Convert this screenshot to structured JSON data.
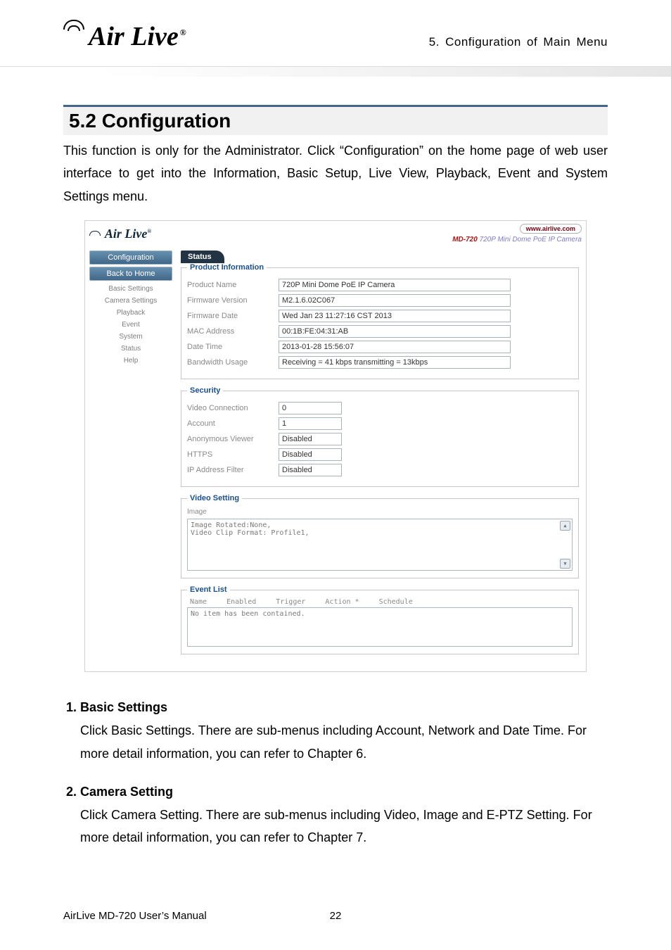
{
  "header": {
    "brand": "Air Live",
    "section_label": "5.  Configuration  of  Main  Menu"
  },
  "section_title": "5.2 Configuration",
  "section_paragraph": "This function is only for the Administrator. Click “Configuration” on the home page of web user interface to get into the Information, Basic Setup, Live View, Playback, Event and System Settings menu.",
  "ui": {
    "top": {
      "brand": "Air Live",
      "url": "www.airlive.com",
      "product_code": "MD-720",
      "product_desc": "720P Mini Dome PoE IP Camera"
    },
    "sidebar": {
      "header1": "Configuration",
      "header2": "Back to Home",
      "items": [
        "Basic Settings",
        "Camera Settings",
        "Playback",
        "Event",
        "System",
        "Status",
        "Help"
      ]
    },
    "main": {
      "tab": "Status",
      "product_info": {
        "legend": "Product Information",
        "product_name_label": "Product Name",
        "product_name": "720P Mini Dome PoE IP Camera",
        "firmware_version_label": "Firmware Version",
        "firmware_version": "M2.1.6.02C067",
        "firmware_date_label": "Firmware Date",
        "firmware_date": "Wed Jan 23 11:27:16 CST 2013",
        "mac_label": "MAC Address",
        "mac": "00:1B:FE:04:31:AB",
        "datetime_label": "Date Time",
        "datetime": "2013-01-28  15:56:07",
        "bandwidth_label": "Bandwidth Usage",
        "bandwidth": "Receiving = 41 kbps transmitting = 13kbps"
      },
      "security": {
        "legend": "Security",
        "video_conn_label": "Video Connection",
        "video_conn": "0",
        "account_label": "Account",
        "account": "1",
        "anon_label": "Anonymous Viewer",
        "anon": "Disabled",
        "https_label": "HTTPS",
        "https": "Disabled",
        "ipfilter_label": "IP Address Filter",
        "ipfilter": "Disabled"
      },
      "video": {
        "legend": "Video Setting",
        "sublegend": "Image",
        "line1": "Image Rotated:None,",
        "line2": "Video Clip Format: Profile1,"
      },
      "eventlist": {
        "legend": "Event List",
        "cols": [
          "Name",
          "Enabled",
          "Trigger",
          "Action *",
          "Schedule"
        ],
        "empty": "No item has been contained."
      }
    }
  },
  "points": [
    {
      "title": "Basic Settings",
      "body": "Click Basic Settings. There are sub-menus including Account, Network and Date Time. For more detail information, you can refer to Chapter 6."
    },
    {
      "title": "Camera Setting",
      "body": "Click Camera Setting. There are sub-menus including Video, Image and E-PTZ Setting. For more detail information, you can refer to Chapter 7."
    }
  ],
  "footer": {
    "left": "AirLive MD-720 User’s Manual",
    "page": "22"
  }
}
